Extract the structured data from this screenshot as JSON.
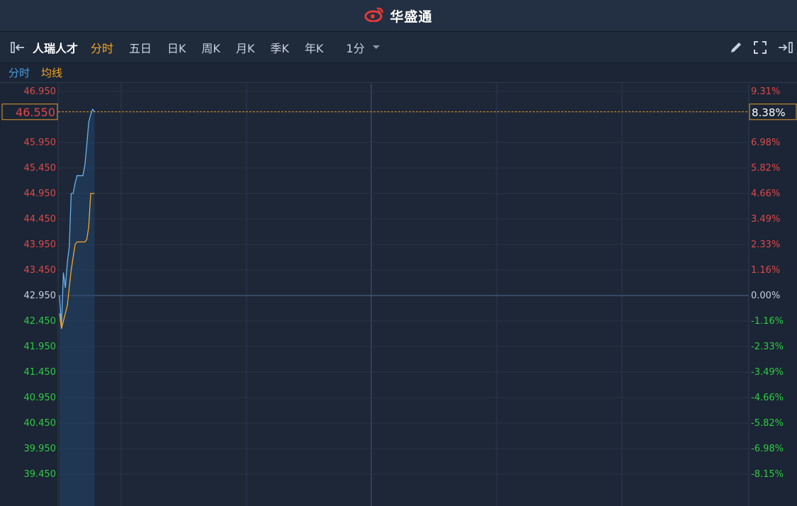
{
  "app": {
    "title": "华盛通",
    "colors": {
      "brand_red": "#e53935",
      "accent": "#f5a623",
      "up": "#e53935",
      "down": "#2ecc40",
      "price_line": "#6ab2ef",
      "avg_line": "#f5a623",
      "background": "#1b2535"
    }
  },
  "toolbar": {
    "stock_name": "人瑞人才",
    "tabs": [
      {
        "label": "分时",
        "active": true
      },
      {
        "label": "五日",
        "active": false
      },
      {
        "label": "日K",
        "active": false
      },
      {
        "label": "周K",
        "active": false
      },
      {
        "label": "月K",
        "active": false
      },
      {
        "label": "季K",
        "active": false
      },
      {
        "label": "年K",
        "active": false
      }
    ],
    "interval": "1分",
    "icons": [
      "collapse-left-icon",
      "pencil-icon",
      "fullscreen-icon",
      "expand-right-icon"
    ]
  },
  "legend": {
    "price": "分时",
    "avg": "均线"
  },
  "chart_data": {
    "type": "line",
    "y_left_ticks": [
      "46.950",
      "45.950",
      "45.450",
      "44.950",
      "44.450",
      "43.950",
      "43.450",
      "42.950",
      "42.450",
      "41.950",
      "41.450",
      "40.950",
      "40.450",
      "39.950",
      "39.450"
    ],
    "y_right_ticks": [
      "9.31%",
      "6.98%",
      "5.82%",
      "4.66%",
      "3.49%",
      "2.33%",
      "1.16%",
      "0.00%",
      "-1.16%",
      "-2.33%",
      "-3.49%",
      "-4.66%",
      "-5.82%",
      "-6.98%",
      "-8.15%"
    ],
    "prev_close": 42.95,
    "ylim": [
      39.2,
      46.95
    ],
    "x_minutes_total": 330,
    "current_price": "46.550",
    "current_change": "8.38%",
    "series": [
      {
        "name": "分时",
        "values": [
          42.95,
          42.35,
          43.4,
          43.1,
          43.6,
          43.9,
          44.95,
          44.95,
          45.15,
          45.3,
          45.3,
          45.3,
          45.3,
          45.5,
          45.9,
          46.35,
          46.5,
          46.6,
          46.55
        ]
      },
      {
        "name": "均线",
        "values": [
          42.6,
          42.3,
          42.45,
          42.6,
          42.75,
          43.1,
          43.45,
          43.7,
          43.95,
          44.0,
          44.0,
          44.0,
          44.0,
          44.0,
          44.05,
          44.3,
          44.95,
          44.95,
          44.95
        ]
      }
    ]
  }
}
